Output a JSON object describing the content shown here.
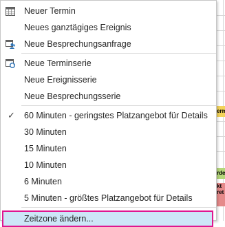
{
  "background": {
    "appointments": [
      {
        "text": "ermin",
        "color": "#f3d35a"
      },
      {
        "text": "rde",
        "color": "#b5d77a"
      },
      {
        "text": "kt ret",
        "color": "#e58a8a"
      }
    ]
  },
  "menu": {
    "groups": [
      [
        {
          "label": "Neuer Termin",
          "icon": "calendar-grid-icon"
        },
        {
          "label": "Neues ganztägiges Ereignis",
          "icon": ""
        },
        {
          "label": "Neue Besprechungsanfrage",
          "icon": "meeting-people-icon"
        }
      ],
      [
        {
          "label": "Neue Terminserie",
          "icon": "recurring-appointment-icon"
        },
        {
          "label": "Neue Ereignisserie",
          "icon": ""
        },
        {
          "label": "Neue Besprechungsserie",
          "icon": ""
        }
      ],
      [
        {
          "label": "60 Minuten - geringstes Platzangebot für Details",
          "checked": true
        },
        {
          "label": "30 Minuten"
        },
        {
          "label": "15 Minuten"
        },
        {
          "label": "10 Minuten"
        },
        {
          "label": "6 Minuten"
        },
        {
          "label": "5 Minuten - größtes Platzangebot für Details"
        }
      ],
      [
        {
          "label": "Zeitzone ändern...",
          "highlighted": true
        }
      ]
    ],
    "check_glyph": "✓",
    "accent_color": "#e0168f",
    "highlight_color": "#cde6f7"
  }
}
